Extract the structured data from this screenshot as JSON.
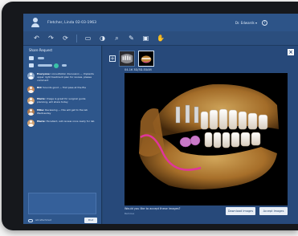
{
  "titlebar": {
    "patient": "Fletcher, Linda   02-03-1963",
    "dropdown": "Dr. Edwards ▾",
    "help": "?"
  },
  "toolbar": {
    "tools": [
      {
        "name": "undo-icon",
        "glyph": "↶"
      },
      {
        "name": "redo-icon",
        "glyph": "↷"
      },
      {
        "name": "refresh-icon",
        "glyph": "⟳"
      },
      {
        "name": "ruler-icon",
        "glyph": "▭"
      },
      {
        "name": "contrast-icon",
        "glyph": "◑"
      },
      {
        "name": "zoom-icon",
        "glyph": "⌕"
      },
      {
        "name": "annotate-icon",
        "glyph": "✎"
      },
      {
        "name": "image-icon",
        "glyph": "▣"
      },
      {
        "name": "hand-icon",
        "glyph": "✋"
      }
    ]
  },
  "sidebar": {
    "title": "Share Request",
    "messages": [
      {
        "author": "Everyone:",
        "text": "consultation discussion — Implants upper right treatment plan for review, please comment",
        "color": "#8aa6c8"
      },
      {
        "author": "Bill:",
        "text": "Sounds good — first pass at the file",
        "color": "#c98a5a"
      },
      {
        "author": "Marie:",
        "text": "Image is great for surgical guide planning, will share today",
        "color": "#d1a06f"
      },
      {
        "author": "Mike:",
        "text": "Reviewing — this will get to the lab Wednesday",
        "color": "#b07b4f"
      },
      {
        "author": "Marie:",
        "text": "Excellent, will review once ready for lab",
        "color": "#d1a06f"
      }
    ],
    "footer_link": "Add attachment",
    "post_label": "Post"
  },
  "main": {
    "image_label": "04-16  3D/3D-EXAM",
    "question": "Would you like to accept these images?",
    "sub": "Remove",
    "download_label": "Download Images",
    "accept_label": "Accept Images",
    "add_glyph": "+",
    "close_glyph": "×"
  }
}
